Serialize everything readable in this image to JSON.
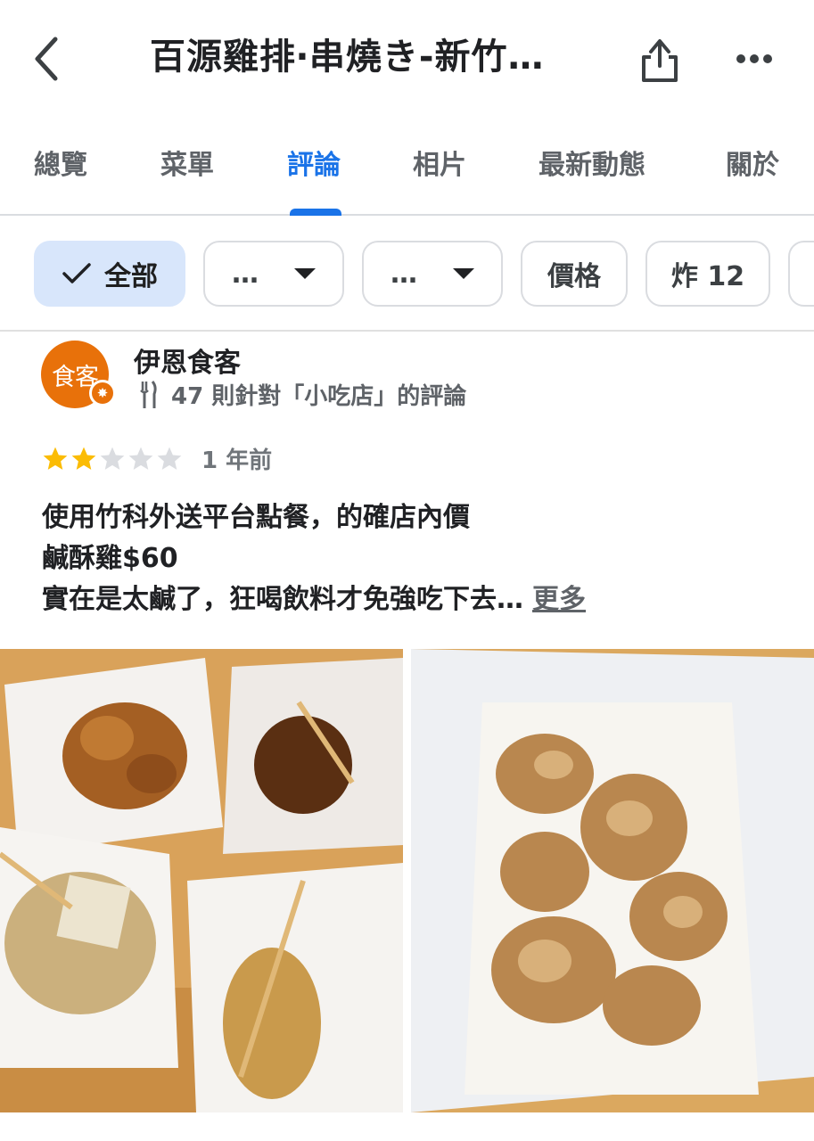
{
  "header": {
    "title": "百源雞排‧串燒き-新竹…",
    "back_icon": "back-arrow-icon",
    "share_icon": "share-icon",
    "more_icon": "more-dots-icon"
  },
  "tabs": [
    {
      "label": "總覽"
    },
    {
      "label": "菜單"
    },
    {
      "label": "評論",
      "active": true
    },
    {
      "label": "相片"
    },
    {
      "label": "最新動態"
    },
    {
      "label": "關於"
    }
  ],
  "chips": {
    "all": "全部",
    "dropdown1": "…",
    "dropdown2": "…",
    "price": "價格",
    "fried": "炸 12"
  },
  "review": {
    "avatar_text": "食客",
    "reviewer_name": "伊恩食客",
    "reviewer_meta": "47 則針對「小吃店」的評論",
    "rating": 2,
    "rating_max": 5,
    "time": "1 年前",
    "text_lines": [
      "使用竹科外送平台點餐，的確店內價",
      "鹹酥雞$60",
      "實在是太鹹了，狂喝飲料才免強吃下去…"
    ],
    "more_label": "更多"
  },
  "colors": {
    "accent": "#1a73e8",
    "chip_selected_bg": "#d8e6fb",
    "avatar": "#e8710a",
    "star_filled": "#fbbc04",
    "star_empty": "#dadce0"
  }
}
